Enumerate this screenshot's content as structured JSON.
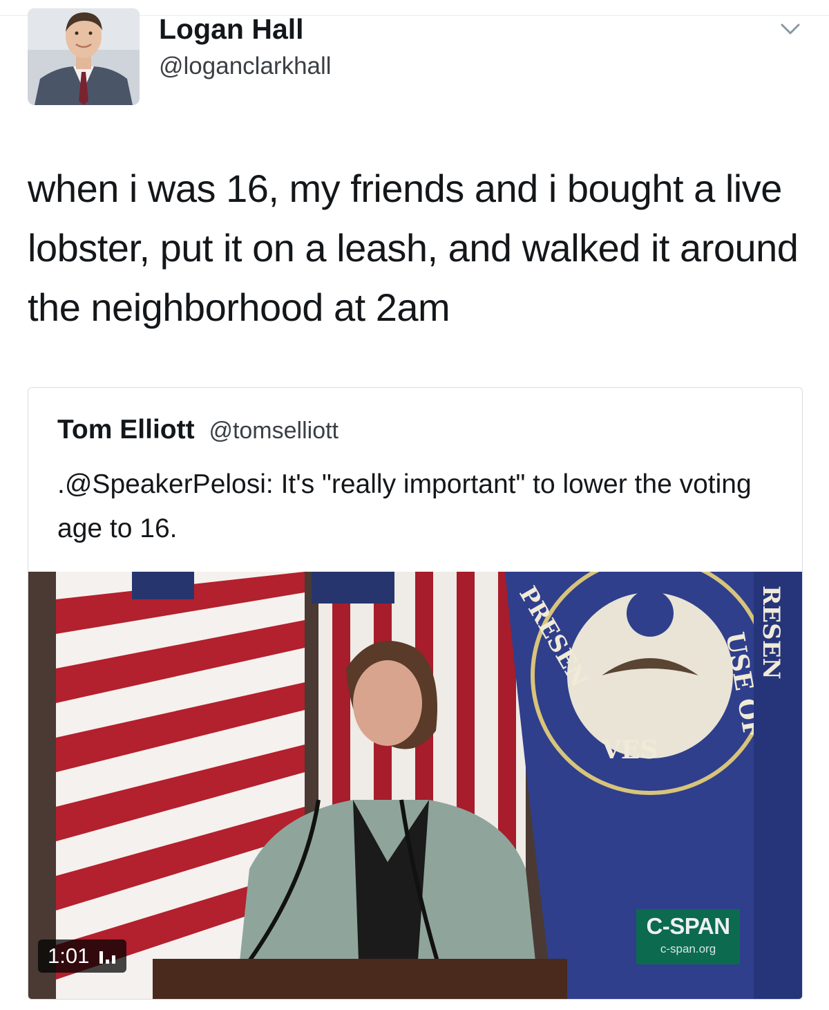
{
  "author": {
    "display_name": "Logan Hall",
    "handle": "@loganclarkhall"
  },
  "tweet": {
    "text": "when i was 16, my friends and i bought a live lobster, put it on a leash, and walked it around the neighborhood at 2am"
  },
  "quoted_tweet": {
    "display_name": "Tom Elliott",
    "handle": "@tomselliott",
    "text": ".@SpeakerPelosi: It's \"really important\" to lower the voting age to 16."
  },
  "video": {
    "duration": "1:01",
    "stats_icon": "bar-chart-icon",
    "watermark": {
      "main": "C-SPAN",
      "sub": "c-span.org"
    }
  },
  "icons": {
    "menu": "chevron-down-icon"
  },
  "colors": {
    "text": "#14171a",
    "secondary_text": "#3b3f44",
    "border": "#d8dde2",
    "cspan_green": "#0a6e4a"
  }
}
